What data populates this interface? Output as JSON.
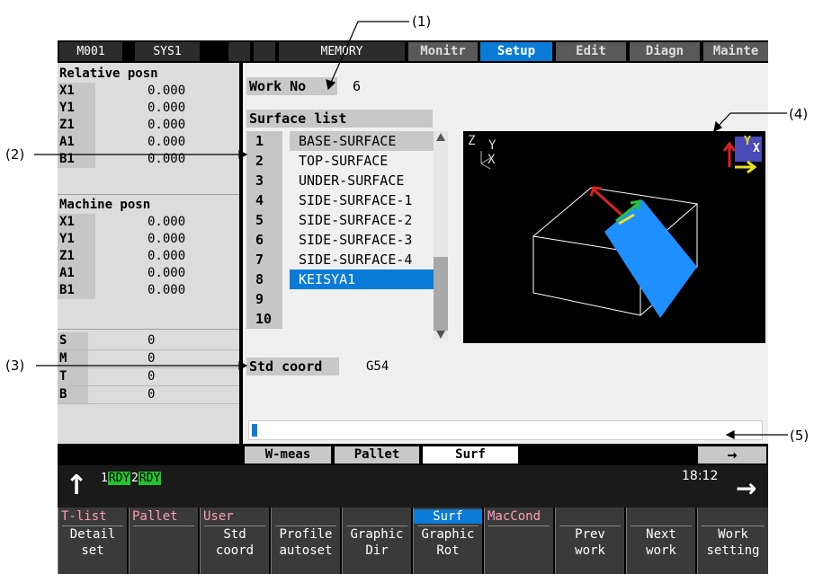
{
  "status_bar": {
    "cells": [
      "M001",
      "SYS1",
      "",
      "",
      "MEMORY"
    ],
    "tabs": [
      {
        "label": "Monitr",
        "active": false
      },
      {
        "label": "Setup",
        "active": true
      },
      {
        "label": "Edit",
        "active": false
      },
      {
        "label": "Diagn",
        "active": false
      },
      {
        "label": "Mainte",
        "active": false
      }
    ]
  },
  "relative": {
    "title": "Relative posn",
    "rows": [
      {
        "axis": "X1",
        "value": "0.000"
      },
      {
        "axis": "Y1",
        "value": "0.000"
      },
      {
        "axis": "Z1",
        "value": "0.000"
      },
      {
        "axis": "A1",
        "value": "0.000"
      },
      {
        "axis": "B1",
        "value": "0.000"
      }
    ]
  },
  "machine": {
    "title": "Machine posn",
    "rows": [
      {
        "axis": "X1",
        "value": "0.000"
      },
      {
        "axis": "Y1",
        "value": "0.000"
      },
      {
        "axis": "Z1",
        "value": "0.000"
      },
      {
        "axis": "A1",
        "value": "0.000"
      },
      {
        "axis": "B1",
        "value": "0.000"
      }
    ]
  },
  "modal": [
    {
      "key": "S",
      "value": "0"
    },
    {
      "key": "M",
      "value": "0"
    },
    {
      "key": "T",
      "value": "0"
    },
    {
      "key": "B",
      "value": "0"
    }
  ],
  "work": {
    "label": "Work No",
    "value": "6"
  },
  "surface_list": {
    "title": "Surface list",
    "items": [
      {
        "num": "1",
        "name": "BASE-SURFACE"
      },
      {
        "num": "2",
        "name": "TOP-SURFACE"
      },
      {
        "num": "3",
        "name": "UNDER-SURFACE"
      },
      {
        "num": "4",
        "name": "SIDE-SURFACE-1"
      },
      {
        "num": "5",
        "name": "SIDE-SURFACE-2"
      },
      {
        "num": "6",
        "name": "SIDE-SURFACE-3"
      },
      {
        "num": "7",
        "name": "SIDE-SURFACE-4"
      },
      {
        "num": "8",
        "name": "KEISYA1"
      },
      {
        "num": "9",
        "name": ""
      },
      {
        "num": "10",
        "name": ""
      }
    ],
    "selected_index": 7
  },
  "std_coord": {
    "label": "Std coord",
    "value": "G54"
  },
  "graphic_axes": {
    "z": "Z",
    "y": "Y",
    "x": "X"
  },
  "sub_tabs": [
    "W-meas",
    "Pallet",
    "Surf"
  ],
  "sub_tab_arrow": "→",
  "ready": [
    {
      "num": "1",
      "label": "RDY"
    },
    {
      "num": "2",
      "label": "RDY"
    }
  ],
  "clock": "18:12",
  "function_keys": [
    {
      "top": "T-list",
      "bottom1": "Detail",
      "bottom2": "set",
      "active": false
    },
    {
      "top": "Pallet",
      "bottom1": "",
      "bottom2": "",
      "active": false
    },
    {
      "top": "User",
      "bottom1": "Std",
      "bottom2": "coord",
      "active": false
    },
    {
      "top": "",
      "bottom1": "Profile",
      "bottom2": "autoset",
      "active": false
    },
    {
      "top": "",
      "bottom1": "Graphic",
      "bottom2": "Dir",
      "active": false
    },
    {
      "top": "Surf",
      "bottom1": "Graphic",
      "bottom2": "Rot",
      "active": true
    },
    {
      "top": "MacCond",
      "bottom1": "",
      "bottom2": "",
      "active": false
    },
    {
      "top": "",
      "bottom1": "Prev",
      "bottom2": "work",
      "active": false
    },
    {
      "top": "",
      "bottom1": "Next",
      "bottom2": "work",
      "active": false
    },
    {
      "top": "",
      "bottom1": "Work",
      "bottom2": "setting",
      "active": false
    }
  ],
  "annotations": [
    "(1)",
    "(2)",
    "(3)",
    "(4)",
    "(5)"
  ],
  "colors": {
    "accent": "#0a7cd8",
    "ready_green": "#22c32e",
    "surface_blue": "#1e8fff"
  }
}
